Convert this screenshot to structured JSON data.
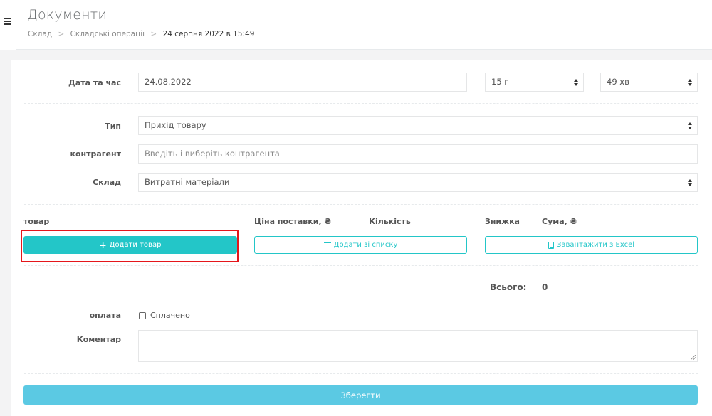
{
  "header": {
    "title": "Документи",
    "breadcrumb": [
      "Склад",
      "Складські операції",
      "24 серпня 2022 в 15:49"
    ]
  },
  "form": {
    "date_label": "Дата та час",
    "date_value": "24.08.2022",
    "hour_value": "15 г",
    "minute_value": "49 хв",
    "type_label": "Тип",
    "type_value": "Прихід товару",
    "counterparty_label": "контрагент",
    "counterparty_placeholder": "Введіть і виберіть контрагента",
    "warehouse_label": "Склад",
    "warehouse_value": "Витратні матеріали"
  },
  "columns": {
    "product": "товар",
    "price": "Ціна поставки, ₴",
    "quantity": "Кількість",
    "discount": "Знижка",
    "sum": "Сума, ₴"
  },
  "buttons": {
    "add_product": "Додати товар",
    "add_from_list": "Додати зі списку",
    "upload_excel": "Завантажити з Excel",
    "save": "Зберегти"
  },
  "totals": {
    "label": "Всього:",
    "value": "0"
  },
  "payment": {
    "label": "оплата",
    "checkbox_label": "Сплачено",
    "paid": false
  },
  "comment": {
    "label": "Коментар",
    "value": ""
  },
  "icons": {
    "menu": "hamburger-icon",
    "add": "plus-icon",
    "list": "list-icon",
    "excel": "file-excel-icon"
  },
  "colors": {
    "accent": "#23c6c8",
    "save": "#5bc9e3",
    "highlight": "#e5161b"
  }
}
